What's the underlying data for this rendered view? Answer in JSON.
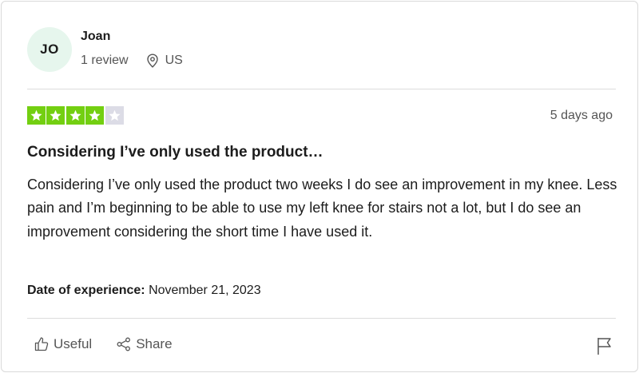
{
  "consumer": {
    "initials": "JO",
    "name": "Joan",
    "reviews": "1 review",
    "location": "US"
  },
  "rating": {
    "stars": 4,
    "max": 5,
    "color_on": "#73cf11",
    "color_off": "#dcdce6"
  },
  "review": {
    "date_ago": "5 days ago",
    "title": "Considering I’ve only used the product…",
    "text": "Considering I’ve only used the product two weeks I do see an improvement in my knee. Less pain and I’m beginning to be able to use my left knee for stairs not a lot, but I do see an improvement considering the short time I have used it.",
    "experience_label": "Date of experience:",
    "experience_date": "November 21, 2023"
  },
  "actions": {
    "useful_label": "Useful",
    "share_label": "Share"
  },
  "icons": {
    "location": "location-pin-icon",
    "useful": "thumbs-up-icon",
    "share": "share-icon",
    "report": "flag-icon"
  }
}
